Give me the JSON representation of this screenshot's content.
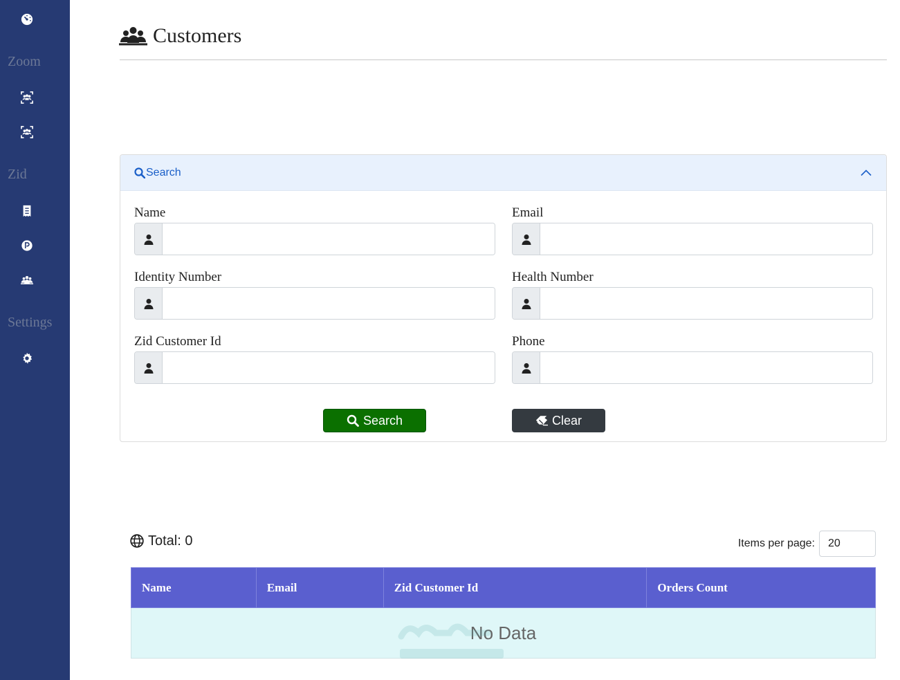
{
  "sidebar": {
    "top_icon": "dashboard-gauge-icon",
    "sections": [
      {
        "label": "Zoom",
        "icons": [
          "zoom-users-icon",
          "zoom-users-icon"
        ]
      },
      {
        "label": "Zid",
        "icons": [
          "receipt-icon",
          "product-p-icon",
          "customers-icon"
        ]
      },
      {
        "label": "Settings",
        "icons": [
          "gear-icon"
        ]
      }
    ]
  },
  "header": {
    "title": "Customers",
    "icon": "customers-icon"
  },
  "search_panel": {
    "title": "Search",
    "fields": [
      {
        "label": "Name",
        "value": "",
        "placeholder": ""
      },
      {
        "label": "Email",
        "value": "",
        "placeholder": ""
      },
      {
        "label": "Identity Number",
        "value": "",
        "placeholder": ""
      },
      {
        "label": "Health Number",
        "value": "",
        "placeholder": ""
      },
      {
        "label": "Zid Customer Id",
        "value": "",
        "placeholder": ""
      },
      {
        "label": "Phone",
        "value": "",
        "placeholder": ""
      }
    ],
    "search_button": "Search",
    "clear_button": "Clear"
  },
  "results": {
    "total_label": "Total: 0",
    "items_per_page_label": "Items per page:",
    "items_per_page": "20",
    "columns": [
      "Name",
      "Email",
      "Zid Customer Id",
      "Orders Count"
    ],
    "empty_text": "No Data"
  },
  "colors": {
    "sidebar": "#263a73",
    "search_button": "#0b7000",
    "clear_button": "#343a40",
    "table_header": "#5a5fcf",
    "empty_row": "#dff7f8",
    "panel_header": "#e8f1fd",
    "link": "#1a5fc8"
  }
}
